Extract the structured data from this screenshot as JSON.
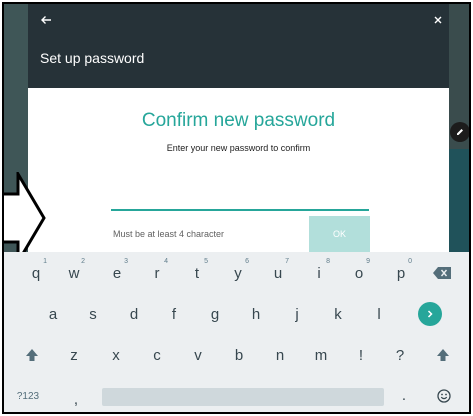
{
  "dialog": {
    "title": "Set up password",
    "heading": "Confirm new password",
    "subtitle": "Enter your new password to confirm",
    "password_value": "",
    "hint": "Must be at least 4 character",
    "ok_label": "OK"
  },
  "icons": {
    "back": "arrow-left-icon",
    "close": "close-icon",
    "edit_badge": "pencil-icon",
    "backspace": "backspace-icon",
    "go": "chevron-right-icon",
    "shift": "shift-icon",
    "emoji": "emoji-icon"
  },
  "colors": {
    "header_bg": "#263238",
    "accent": "#26a69a",
    "ok_disabled": "#b2dfdb",
    "keyboard_bg": "#eceff1"
  },
  "keyboard": {
    "row1": [
      {
        "key": "q",
        "num": "1"
      },
      {
        "key": "w",
        "num": "2"
      },
      {
        "key": "e",
        "num": "3"
      },
      {
        "key": "r",
        "num": "4"
      },
      {
        "key": "t",
        "num": "5"
      },
      {
        "key": "y",
        "num": "6"
      },
      {
        "key": "u",
        "num": "7"
      },
      {
        "key": "i",
        "num": "8"
      },
      {
        "key": "o",
        "num": "9"
      },
      {
        "key": "p",
        "num": "0"
      }
    ],
    "row2": [
      "a",
      "s",
      "d",
      "f",
      "g",
      "h",
      "j",
      "k",
      "l"
    ],
    "row3": [
      "z",
      "x",
      "c",
      "v",
      "b",
      "n",
      "m",
      "!",
      "?"
    ],
    "symbols_label": "?123",
    "comma": ",",
    "period": "."
  }
}
